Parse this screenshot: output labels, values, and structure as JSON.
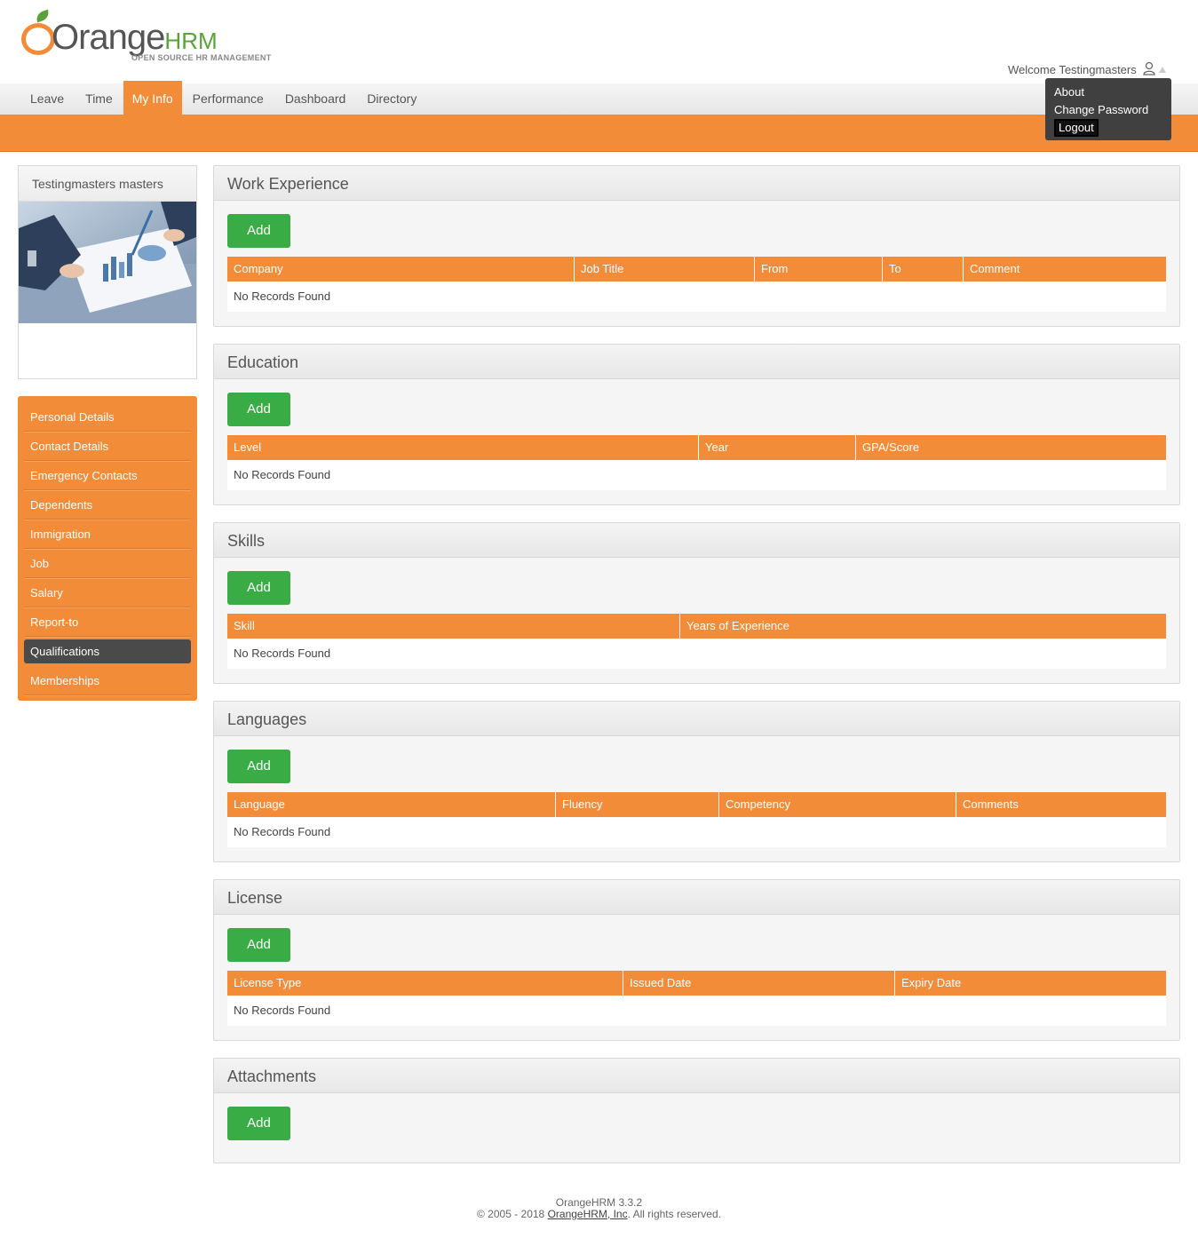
{
  "brand": {
    "logo_main": "Orange",
    "logo_hrm": "HRM",
    "logo_tag": "OPEN SOURCE HR MANAGEMENT"
  },
  "header": {
    "welcome": "Welcome Testingmasters"
  },
  "user_menu": {
    "about": "About",
    "change_password": "Change Password",
    "logout": "Logout"
  },
  "menu": {
    "leave": "Leave",
    "time": "Time",
    "my_info": "My Info",
    "performance": "Performance",
    "dashboard": "Dashboard",
    "directory": "Directory"
  },
  "profile": {
    "name": "Testingmasters masters"
  },
  "sidenav": {
    "items": [
      "Personal Details",
      "Contact Details",
      "Emergency Contacts",
      "Dependents",
      "Immigration",
      "Job",
      "Salary",
      "Report-to",
      "Qualifications",
      "Memberships"
    ],
    "active": "Qualifications"
  },
  "sections": {
    "work_experience": {
      "title": "Work Experience",
      "add": "Add",
      "columns": [
        "Company",
        "Job Title",
        "From",
        "To",
        "Comment"
      ],
      "empty": "No Records Found"
    },
    "education": {
      "title": "Education",
      "add": "Add",
      "columns": [
        "Level",
        "Year",
        "GPA/Score"
      ],
      "empty": "No Records Found"
    },
    "skills": {
      "title": "Skills",
      "add": "Add",
      "columns": [
        "Skill",
        "Years of Experience"
      ],
      "empty": "No Records Found"
    },
    "languages": {
      "title": "Languages",
      "add": "Add",
      "columns": [
        "Language",
        "Fluency",
        "Competency",
        "Comments"
      ],
      "empty": "No Records Found"
    },
    "license": {
      "title": "License",
      "add": "Add",
      "columns": [
        "License Type",
        "Issued Date",
        "Expiry Date"
      ],
      "empty": "No Records Found"
    },
    "attachments": {
      "title": "Attachments",
      "add": "Add"
    }
  },
  "footer": {
    "version": "OrangeHRM 3.3.2",
    "copyright_prefix": "© 2005 - 2018 ",
    "company_link": "OrangeHRM, Inc",
    "copyright_suffix": ". All rights reserved."
  },
  "colors": {
    "accent": "#f28c38",
    "add_button": "#3aac45",
    "active_nav": "#4a4a4a",
    "dropdown": "#404040"
  }
}
